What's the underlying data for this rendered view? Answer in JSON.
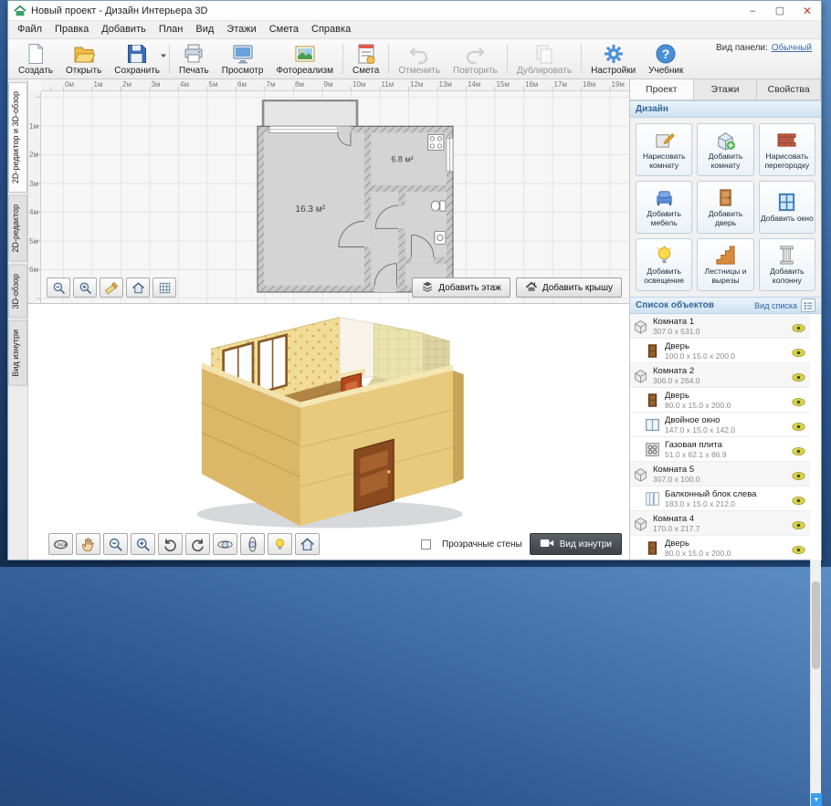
{
  "window": {
    "title": "Новый проект - Дизайн Интерьера 3D"
  },
  "menu": {
    "items": [
      "Файл",
      "Правка",
      "Добавить",
      "План",
      "Вид",
      "Этажи",
      "Смета",
      "Справка"
    ]
  },
  "toolbar": {
    "view_panel_label": "Вид панели:",
    "view_panel_value": "Обычный",
    "groups": [
      {
        "buttons": [
          {
            "label": "Создать",
            "icon": "new-doc"
          },
          {
            "label": "Открыть",
            "icon": "open-folder"
          },
          {
            "label": "Сохранить",
            "icon": "save",
            "dropdown": true
          }
        ]
      },
      {
        "buttons": [
          {
            "label": "Печать",
            "icon": "print"
          },
          {
            "label": "Просмотр",
            "icon": "preview"
          },
          {
            "label": "Фотореализм",
            "icon": "photo"
          }
        ]
      },
      {
        "buttons": [
          {
            "label": "Смета",
            "icon": "estimate"
          }
        ]
      },
      {
        "buttons": [
          {
            "label": "Отменить",
            "icon": "undo",
            "disabled": true
          },
          {
            "label": "Повторить",
            "icon": "redo",
            "disabled": true
          }
        ]
      },
      {
        "buttons": [
          {
            "label": "Дублировать",
            "icon": "duplicate",
            "disabled": true
          }
        ]
      },
      {
        "buttons": [
          {
            "label": "Настройки",
            "icon": "gear"
          },
          {
            "label": "Учебник",
            "icon": "help"
          }
        ]
      }
    ]
  },
  "left_tabs": [
    "2D-редактор и 3D-обзор",
    "2D-редактор",
    "3D-обзор",
    "Вид изнутри"
  ],
  "plan2d": {
    "ruler_h": [
      "0м",
      "1м",
      "2м",
      "3м",
      "4м",
      "5м",
      "6м",
      "7м",
      "8м",
      "9м",
      "10м",
      "11м",
      "12м",
      "13м",
      "14м",
      "15м",
      "16м",
      "17м",
      "18м",
      "19м"
    ],
    "ruler_v": [
      "1м",
      "2м",
      "3м",
      "4м",
      "5м",
      "6м"
    ],
    "room1_label": "16.3 м²",
    "room2_label": "6.8 м²",
    "tools": [
      "zoom-out",
      "zoom-in",
      "measure",
      "home",
      "grid"
    ],
    "add_floor_label": "Добавить этаж",
    "add_roof_label": "Добавить крышу"
  },
  "view3d": {
    "tools": [
      "view-360",
      "pan-hand",
      "zoom-out",
      "zoom-in",
      "rotate-l",
      "rotate-r",
      "orbit-h",
      "orbit-v",
      "bulb",
      "home"
    ],
    "transparent_walls_label": "Прозрачные стены",
    "inside_view_label": "Вид изнутри"
  },
  "right_panel": {
    "tabs": [
      "Проект",
      "Этажи",
      "Свойства"
    ],
    "design_header": "Дизайн",
    "design_buttons": [
      {
        "label": "Нарисовать комнату",
        "icon": "draw-room"
      },
      {
        "label": "Добавить комнату",
        "icon": "add-room"
      },
      {
        "label": "Нарисовать перегородку",
        "icon": "draw-partition"
      },
      {
        "label": "Добавить мебель",
        "icon": "add-furniture"
      },
      {
        "label": "Добавить дверь",
        "icon": "add-door"
      },
      {
        "label": "Добавить окно",
        "icon": "add-window"
      },
      {
        "label": "Добавить освещение",
        "icon": "add-light"
      },
      {
        "label": "Лестницы и вырезы",
        "icon": "stairs"
      },
      {
        "label": "Добавить колонну",
        "icon": "add-column"
      }
    ],
    "objects_header": "Список объектов",
    "list_view_label": "Вид списка",
    "objects": [
      {
        "name": "Комната 1",
        "dims": "307.0 x 531.0",
        "icon": "room",
        "child": false
      },
      {
        "name": "Дверь",
        "dims": "100.0 x 15.0 x 200.0",
        "icon": "door",
        "child": true
      },
      {
        "name": "Комната 2",
        "dims": "306.0 x 264.0",
        "icon": "room",
        "child": false
      },
      {
        "name": "Дверь",
        "dims": "80.0 x 15.0 x 200.0",
        "icon": "door",
        "child": true
      },
      {
        "name": "Двойное окно",
        "dims": "147.0 x 15.0 x 142.0",
        "icon": "window",
        "child": true
      },
      {
        "name": "Газовая плита",
        "dims": "51.0 x 62.1 x 86.9",
        "icon": "stove",
        "child": true
      },
      {
        "name": "Комната 5",
        "dims": "307.0 x 100.0",
        "icon": "room",
        "child": false
      },
      {
        "name": "Балконный блок слева",
        "dims": "183.0 x 15.0 x 212.0",
        "icon": "balcony",
        "child": true
      },
      {
        "name": "Комната 4",
        "dims": "170.0 x 217.7",
        "icon": "room",
        "child": false
      },
      {
        "name": "Дверь",
        "dims": "80.0 x 15.0 x 200.0",
        "icon": "door",
        "child": true
      }
    ]
  },
  "colors": {
    "accent": "#33669c",
    "panel_header": "#d8e7f5",
    "eye": "#d8d44a"
  }
}
